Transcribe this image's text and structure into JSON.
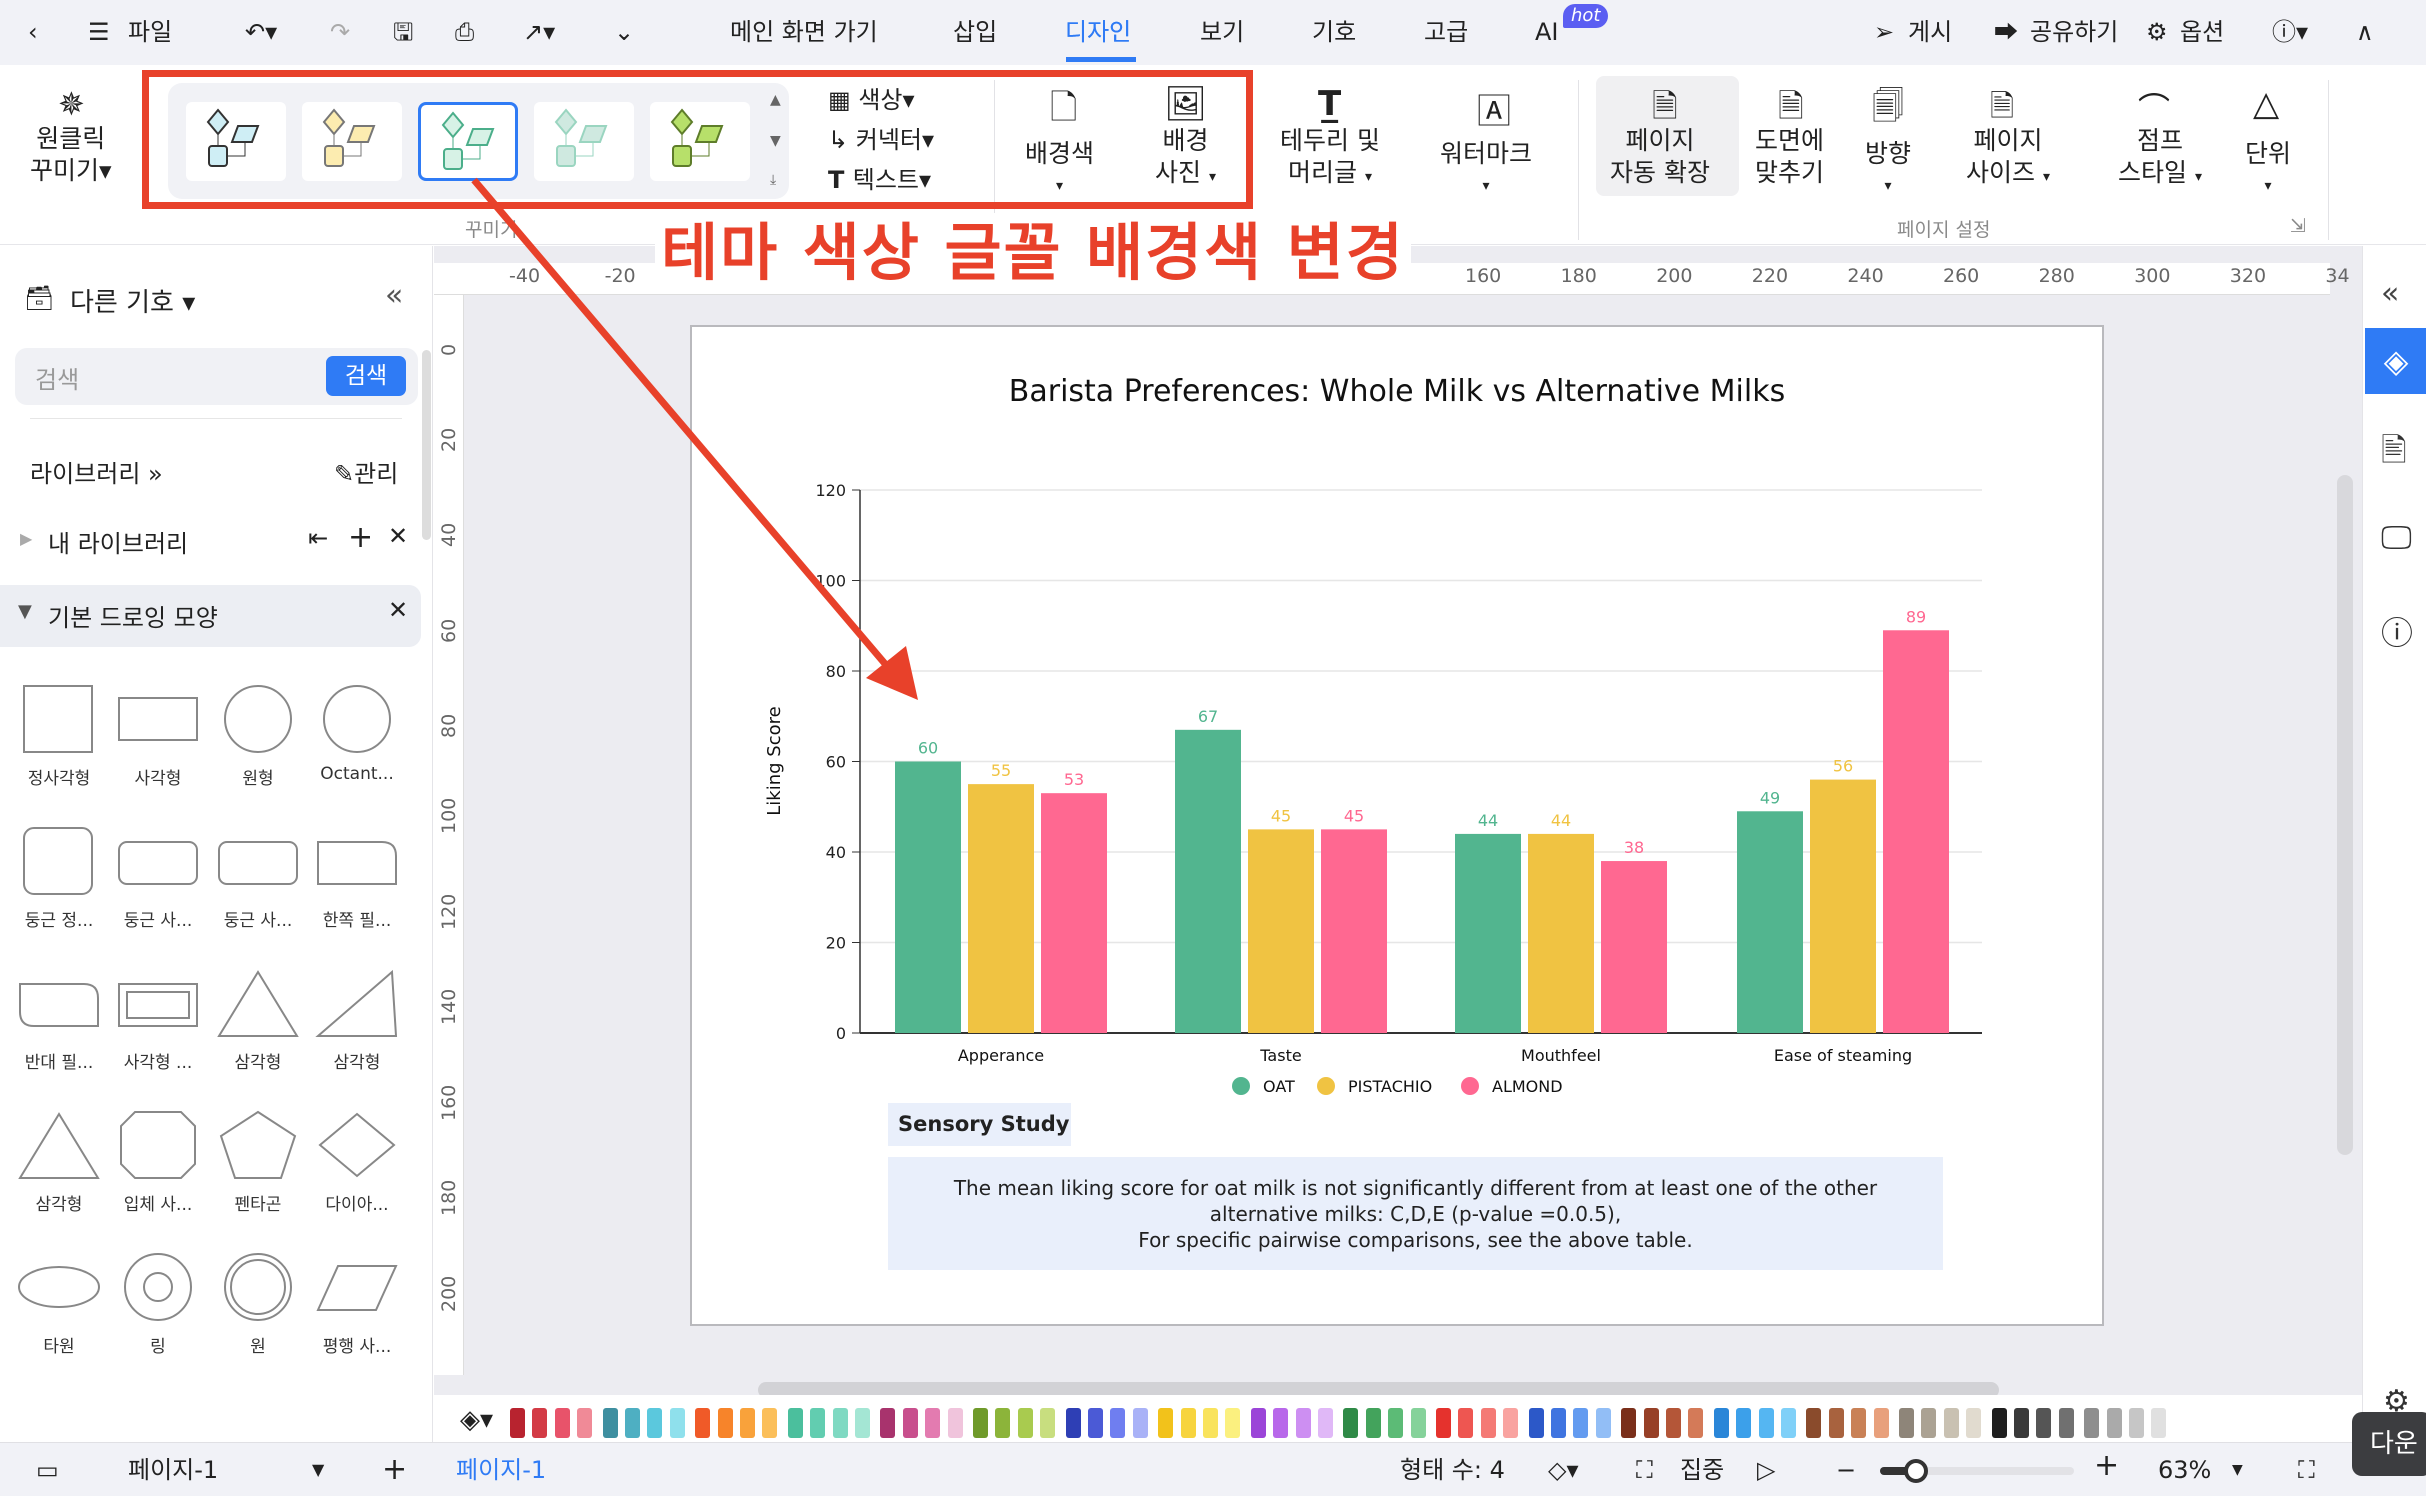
{
  "topbar": {
    "file": "파일",
    "tabs": [
      "메인 화면 가기",
      "삽입",
      "디자인",
      "보기",
      "기호",
      "고급",
      "AI"
    ],
    "active_tab": "디자인",
    "hot_badge": "hot",
    "publish": "게시",
    "share": "공유하기",
    "options": "옵션"
  },
  "ribbon": {
    "one_click": [
      "원클릭",
      "꾸미기"
    ],
    "color": "색상",
    "connector": "커넥터",
    "text": "텍스트",
    "bg_color": "배경색",
    "bg_image": [
      "배경",
      "사진"
    ],
    "border_header": [
      "테두리 및",
      "머리글"
    ],
    "watermark": "워터마크",
    "auto_extend": [
      "페이지",
      "자동 확장"
    ],
    "fit_drawing": [
      "도면에",
      "맞추기"
    ],
    "orientation": "방향",
    "page_size": [
      "페이지",
      "사이즈"
    ],
    "jump_style": [
      "점프",
      "스타일"
    ],
    "unit": "단위",
    "group_decorate": "꾸미기",
    "group_page_setup": "페이지 설정",
    "theme_colors": [
      "#cfeef5",
      "#fcecb0",
      "#d7f2e6",
      "#cfe9e0",
      "#b7e06a"
    ],
    "theme_strokes": [
      "#333333",
      "#777777",
      "#4bae8a",
      "#9ad5c0",
      "#5e7d2a"
    ],
    "selected_theme": 2
  },
  "annotation": {
    "text": "테마 색상 글꼴 배경색 변경",
    "color": "#e8412a"
  },
  "sidebar": {
    "title": "다른 기호",
    "search_placeholder": "검색",
    "search_button": "검색",
    "library": "라이브러리",
    "manage": "관리",
    "my_library": "내 라이브러리",
    "basic_shapes": "기본 드로잉 모양",
    "shapes": [
      {
        "label": "정사각형",
        "icon": "square"
      },
      {
        "label": "사각형",
        "icon": "rectangle"
      },
      {
        "label": "원형",
        "icon": "circle"
      },
      {
        "label": "Octant...",
        "icon": "octant"
      },
      {
        "label": "둥근 정...",
        "icon": "rounded-square"
      },
      {
        "label": "둥근 사...",
        "icon": "rounded-rect"
      },
      {
        "label": "둥근 사...",
        "icon": "rounded-rect2"
      },
      {
        "label": "한쪽 필...",
        "icon": "one-round"
      },
      {
        "label": "반대 필...",
        "icon": "opposite-round"
      },
      {
        "label": "사각형 ...",
        "icon": "frame"
      },
      {
        "label": "삼각형",
        "icon": "triangle"
      },
      {
        "label": "삼각형",
        "icon": "right-triangle"
      },
      {
        "label": "삼각형",
        "icon": "iso-triangle"
      },
      {
        "label": "입체 사...",
        "icon": "octagon"
      },
      {
        "label": "펜타곤",
        "icon": "pentagon"
      },
      {
        "label": "다이아...",
        "icon": "diamond"
      },
      {
        "label": "타원",
        "icon": "ellipse"
      },
      {
        "label": "링",
        "icon": "ring"
      },
      {
        "label": "원",
        "icon": "double-circle"
      },
      {
        "label": "평행 사...",
        "icon": "parallelogram"
      }
    ]
  },
  "rulers": {
    "h": [
      "-40",
      "-20",
      "160",
      "180",
      "200",
      "220",
      "240",
      "260",
      "280",
      "300",
      "320",
      "34"
    ],
    "v": [
      "0",
      "20",
      "40",
      "60",
      "80",
      "100",
      "120",
      "140",
      "160",
      "180",
      "200"
    ]
  },
  "chart_data": {
    "type": "bar",
    "title": "Barista Preferences: Whole Milk vs Alternative Milks",
    "ylabel": "Liking Score",
    "xlabel": "",
    "ylim": [
      0,
      120
    ],
    "yticks": [
      "0",
      "20",
      "40",
      "60",
      "80",
      "100",
      "120"
    ],
    "grid": true,
    "legend": "bottom",
    "categories": [
      "Apperance",
      "Taste",
      "Mouthfeel",
      "Ease of steaming"
    ],
    "series": [
      {
        "name": "OAT",
        "color": "#52b58f",
        "values": [
          60,
          67,
          44,
          49
        ]
      },
      {
        "name": "PISTACHIO",
        "color": "#f0c342",
        "values": [
          55,
          45,
          44,
          56
        ]
      },
      {
        "name": "ALMOND",
        "color": "#ff6891",
        "values": [
          53,
          45,
          38,
          89
        ]
      }
    ]
  },
  "note": {
    "heading": "Sensory Study",
    "lines": [
      "The mean liking score for oat milk is not significantly different from at least one of the other",
      "alternative milks: C,D,E (p-value =0.0.5),",
      "For specific pairwise comparisons, see the above table."
    ]
  },
  "palette": [
    "#b8232f",
    "#d33b45",
    "#e8536a",
    "#f08a97",
    "#3e8fa0",
    "#4eafc2",
    "#5bc8dd",
    "#8fe0ec",
    "#f05a28",
    "#f7842a",
    "#f9a23b",
    "#fbbf5a",
    "#4bbf9d",
    "#62cdb0",
    "#7fd9c2",
    "#a4e6d4",
    "#a8336d",
    "#c84f8d",
    "#e37bb0",
    "#f0c4dc",
    "#6f9a2a",
    "#8cb43a",
    "#a9cb4f",
    "#c8de7f",
    "#2e3fb5",
    "#4b5ad6",
    "#6f7ef0",
    "#a9b2f7",
    "#f2c21b",
    "#f7d43e",
    "#f9e35c",
    "#fbf07f",
    "#9b45d8",
    "#b868ea",
    "#cd8ff2",
    "#e0b8f7",
    "#2f8a47",
    "#43a35c",
    "#5cbb76",
    "#85d29a",
    "#e5322d",
    "#ee5651",
    "#f47a75",
    "#f9a3a0",
    "#2c58c8",
    "#3f74e0",
    "#639bf0",
    "#92bef6",
    "#7a2f1a",
    "#974027",
    "#b45638",
    "#d47a58",
    "#2a86d8",
    "#3ca0ea",
    "#55b6f2",
    "#7fd0f8",
    "#8a4b2c",
    "#a8623e",
    "#c98156",
    "#e8a07c",
    "#8e8579",
    "#aba293",
    "#c9c1b2",
    "#e1dbcf",
    "#1f1f1f",
    "#3a3a3a",
    "#555555",
    "#707070",
    "#8e8e8e",
    "#aaaaaa",
    "#c6c6c6",
    "#e0e0e0"
  ],
  "statusbar": {
    "page_select": "페이지-1",
    "page_tab": "페이지-1",
    "shape_count": "형태 수: 4",
    "focus": "집중",
    "zoom": "63%",
    "zoom_level": 0.63
  },
  "tooltip": "다운"
}
